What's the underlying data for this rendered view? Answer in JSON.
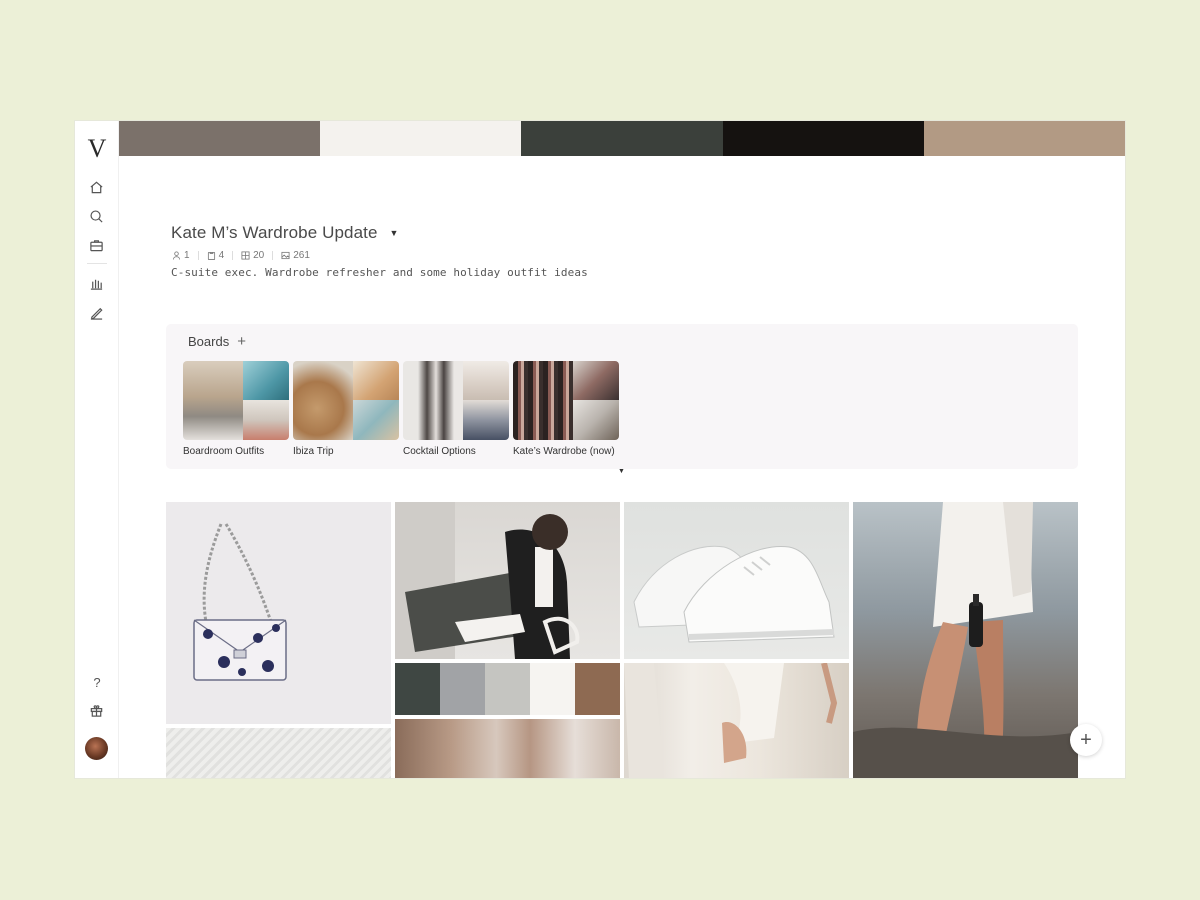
{
  "app": {
    "logo_text": "V"
  },
  "sidebar": {
    "items": [
      {
        "name": "home",
        "icon": "home-icon"
      },
      {
        "name": "search",
        "icon": "search-icon"
      },
      {
        "name": "briefcase",
        "icon": "briefcase-icon"
      },
      {
        "name": "library",
        "icon": "library-icon"
      },
      {
        "name": "edit",
        "icon": "pen-icon"
      }
    ],
    "help_label": "?",
    "gift_icon": "gift-icon"
  },
  "palette": {
    "colors": [
      "#7b716a",
      "#f4f2ee",
      "#3b403b",
      "#151210",
      "#b29a84"
    ]
  },
  "project": {
    "title": "Kate M’s Wardrobe Update",
    "stats": {
      "people": "1",
      "boards": "4",
      "grid": "20",
      "images": "261"
    },
    "description": "C-suite exec. Wardrobe refresher and some holiday outfit ideas"
  },
  "boards": {
    "heading": "Boards",
    "add_label": "+",
    "items": [
      {
        "label": "Boardroom Outfits",
        "colors": [
          "#c9b7a2",
          "#6fa9b4",
          "#c7c2bb"
        ]
      },
      {
        "label": "Ibiza Trip",
        "colors": [
          "#b89068",
          "#d5bfa3",
          "#7da6ad"
        ]
      },
      {
        "label": "Cocktail Options",
        "colors": [
          "#6a6361",
          "#d9d4cf",
          "#57606b"
        ]
      },
      {
        "label": "Kate’s Wardrobe (now)",
        "colors": [
          "#3a2d2c",
          "#9e6f66",
          "#cfcac4"
        ]
      }
    ]
  },
  "moodboard": {
    "swatches": [
      "#3f4743",
      "#a1a3a6",
      "#c5c5c1",
      "#f6f4f1",
      "#8e6a52"
    ],
    "photos": [
      "handbag",
      "woman-in-coat",
      "white-sneakers",
      "beach-walk",
      "knit-sweater",
      "beige-bags",
      "white-blazer"
    ]
  },
  "fab_label": "+"
}
